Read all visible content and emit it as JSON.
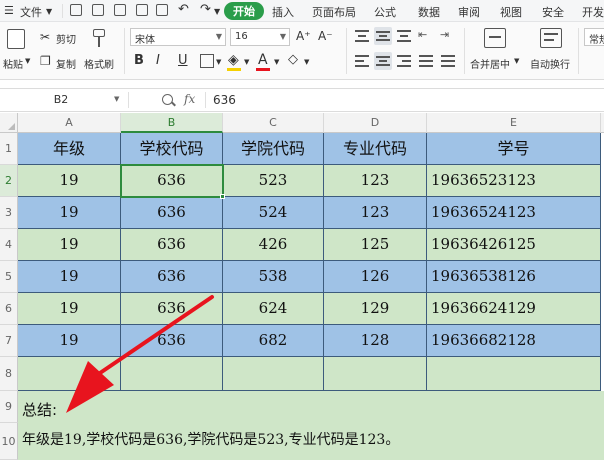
{
  "menubar": {
    "file": "文件",
    "tabs": [
      "开始",
      "插入",
      "页面布局",
      "公式",
      "数据",
      "审阅",
      "视图",
      "安全",
      "开发"
    ]
  },
  "ribbon": {
    "paste": "粘贴",
    "cut": "剪切",
    "copy": "复制",
    "format_painter": "格式刷",
    "font_name": "宋体",
    "font_size": "16",
    "bold": "B",
    "italic": "I",
    "underline": "U",
    "merge_center": "合并居中",
    "wrap_text": "自动换行",
    "number_format": "常规"
  },
  "formula_bar": {
    "cell_ref": "B2",
    "fx": "fx",
    "content": "636"
  },
  "sheet": {
    "columns": [
      "A",
      "B",
      "C",
      "D",
      "E"
    ],
    "rows": [
      "1",
      "2",
      "3",
      "4",
      "5",
      "6",
      "7",
      "8",
      "9",
      "10"
    ],
    "headers": [
      "年级",
      "学校代码",
      "学院代码",
      "专业代码",
      "学号"
    ],
    "data": [
      [
        "19",
        "636",
        "523",
        "123",
        "19636523123"
      ],
      [
        "19",
        "636",
        "524",
        "123",
        "19636524123"
      ],
      [
        "19",
        "636",
        "426",
        "125",
        "19636426125"
      ],
      [
        "19",
        "636",
        "538",
        "126",
        "19636538126"
      ],
      [
        "19",
        "636",
        "624",
        "129",
        "19636624129"
      ],
      [
        "19",
        "636",
        "682",
        "128",
        "19636682128"
      ]
    ],
    "summary_label": "总结:",
    "summary_text": "年级是19,学校代码是636,学院代码是523,专业代码是123。"
  },
  "colors": {
    "accent_green": "#2a9d4a",
    "row_green": "#cfe6c8",
    "row_blue": "#9fc2e6",
    "arrow_red": "#e8141e"
  }
}
